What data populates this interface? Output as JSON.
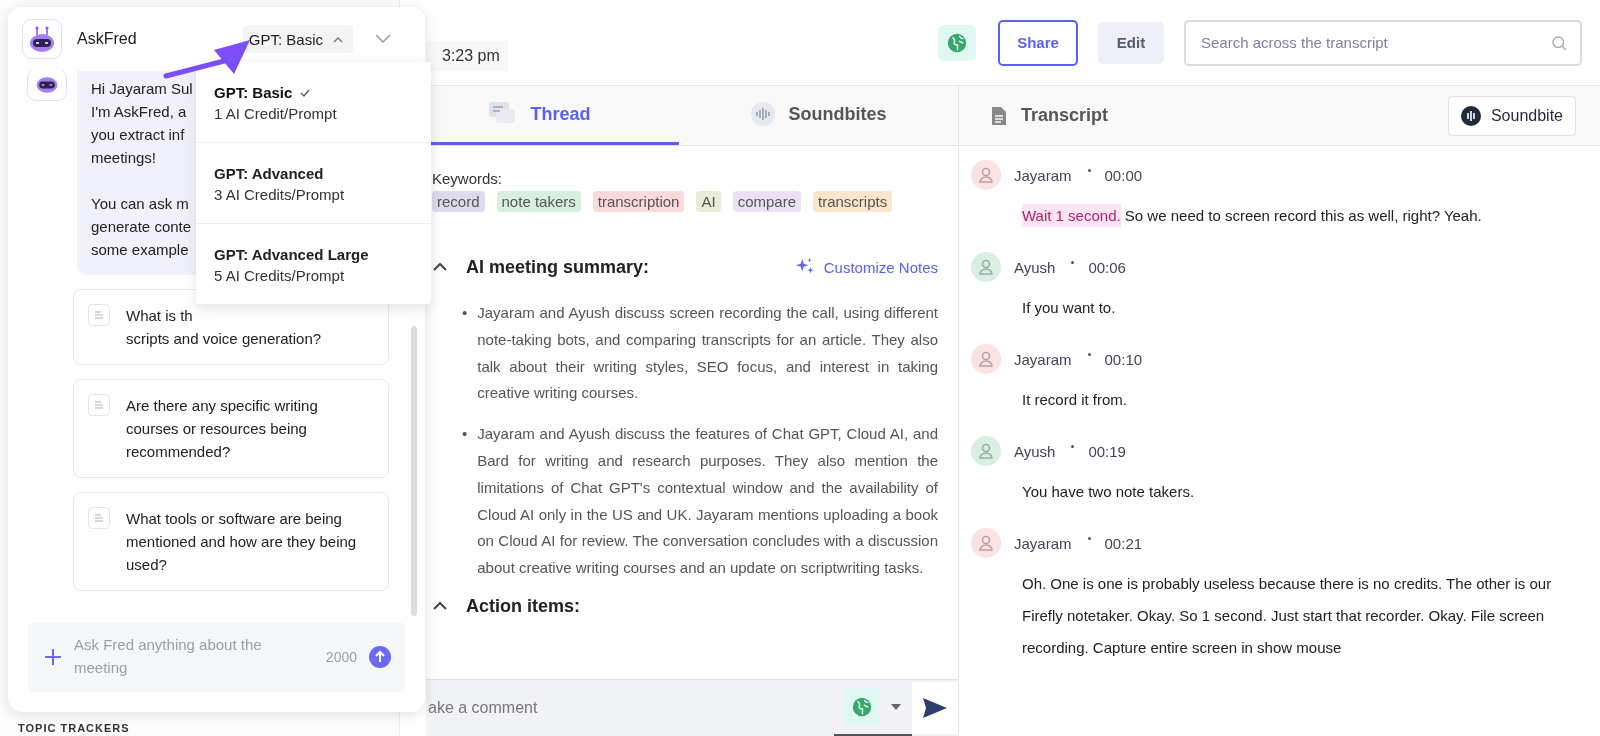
{
  "header": {
    "time": "3:23 pm",
    "share": "Share",
    "edit": "Edit",
    "search": {
      "placeholder": "Search across the transcript"
    }
  },
  "sidebar": {
    "section": "TOPIC TRACKERS"
  },
  "tabs": [
    {
      "label": "Thread",
      "selected": true
    },
    {
      "label": "Soundbites",
      "selected": false
    }
  ],
  "keywords": {
    "label": "Keywords:",
    "tags": [
      {
        "text": "record",
        "color": "#dcdcec"
      },
      {
        "text": "note takers",
        "color": "#d9efdd"
      },
      {
        "text": "transcription",
        "color": "#fadada"
      },
      {
        "text": "AI",
        "color": "#ebebd9"
      },
      {
        "text": "compare",
        "color": "#ebe0f5"
      },
      {
        "text": "transcripts",
        "color": "#fbe6cc"
      }
    ]
  },
  "summary": {
    "title": "AI meeting summary:",
    "expanded": true,
    "action": "Customize Notes",
    "marker": "•",
    "bullets": [
      "Jayaram and Ayush discuss screen recording the call, using different note-taking bots, and comparing transcripts for an article. They also talk about their writing styles, SEO focus, and interest in taking creative writing courses.",
      "Jayaram and Ayush discuss the features of Chat GPT, Cloud AI, and Bard for writing and research purposes. They also mention the limitations of Chat GPT's contextual window and the availability of Cloud AI only in the US and UK. Jayaram mentions uploading a book on Cloud AI for review. The conversation concludes with a discussion about creative writing courses and an update on scriptwriting tasks."
    ]
  },
  "action_items": {
    "title": "Action items:",
    "expanded": true
  },
  "comment": {
    "placeholder": "ake a comment"
  },
  "transcript": {
    "title": "Transcript",
    "button": "Soundbite",
    "entries": [
      {
        "speaker": "Jayaram",
        "time": "00:00",
        "color": "#fbe3e3",
        "highlight": "Wait 1 second.",
        "text": "So we need to screen record this as well, right? Yeah."
      },
      {
        "speaker": "Ayush",
        "time": "00:06",
        "color": "#d9efe1",
        "text": "If you want to."
      },
      {
        "speaker": "Jayaram",
        "time": "00:10",
        "color": "#fbe3e3",
        "text": "It record it from."
      },
      {
        "speaker": "Ayush",
        "time": "00:19",
        "color": "#d9efe1",
        "text": "You have two note takers."
      },
      {
        "speaker": "Jayaram",
        "time": "00:21",
        "color": "#fbe3e3",
        "text": "Oh. One is one is probably useless because there is no credits. The other is our Firefly notetaker. Okay. So 1 second. Just start that recorder. Okay. File screen recording. Capture entire screen in show mouse"
      }
    ]
  },
  "askfred": {
    "title": "AskFred",
    "model": "GPT: Basic",
    "menu_open": true,
    "models": [
      {
        "name": "GPT: Basic",
        "cost": "1 AI Credit/Prompt",
        "selected": true
      },
      {
        "name": "GPT: Advanced",
        "cost": "3 AI Credits/Prompt",
        "selected": false
      },
      {
        "name": "GPT: Advanced Large",
        "cost": "5 AI Credits/Prompt",
        "selected": false
      }
    ],
    "bubble": [
      [
        "Hi Jayaram Sul",
        "I'm AskFred, a",
        "you extract inf",
        "meetings!"
      ],
      [
        "You can ask m",
        "generate conte",
        "some example"
      ]
    ],
    "suggestions": [
      [
        "What is th",
        "scripts and voice generation?"
      ],
      [
        "Are there any specific writing courses or resources being recommended?"
      ],
      [
        "What tools or software are being mentioned and how are they being used?"
      ]
    ],
    "input": {
      "placeholder": "Ask Fred anything about the meeting",
      "count": "2000"
    }
  }
}
